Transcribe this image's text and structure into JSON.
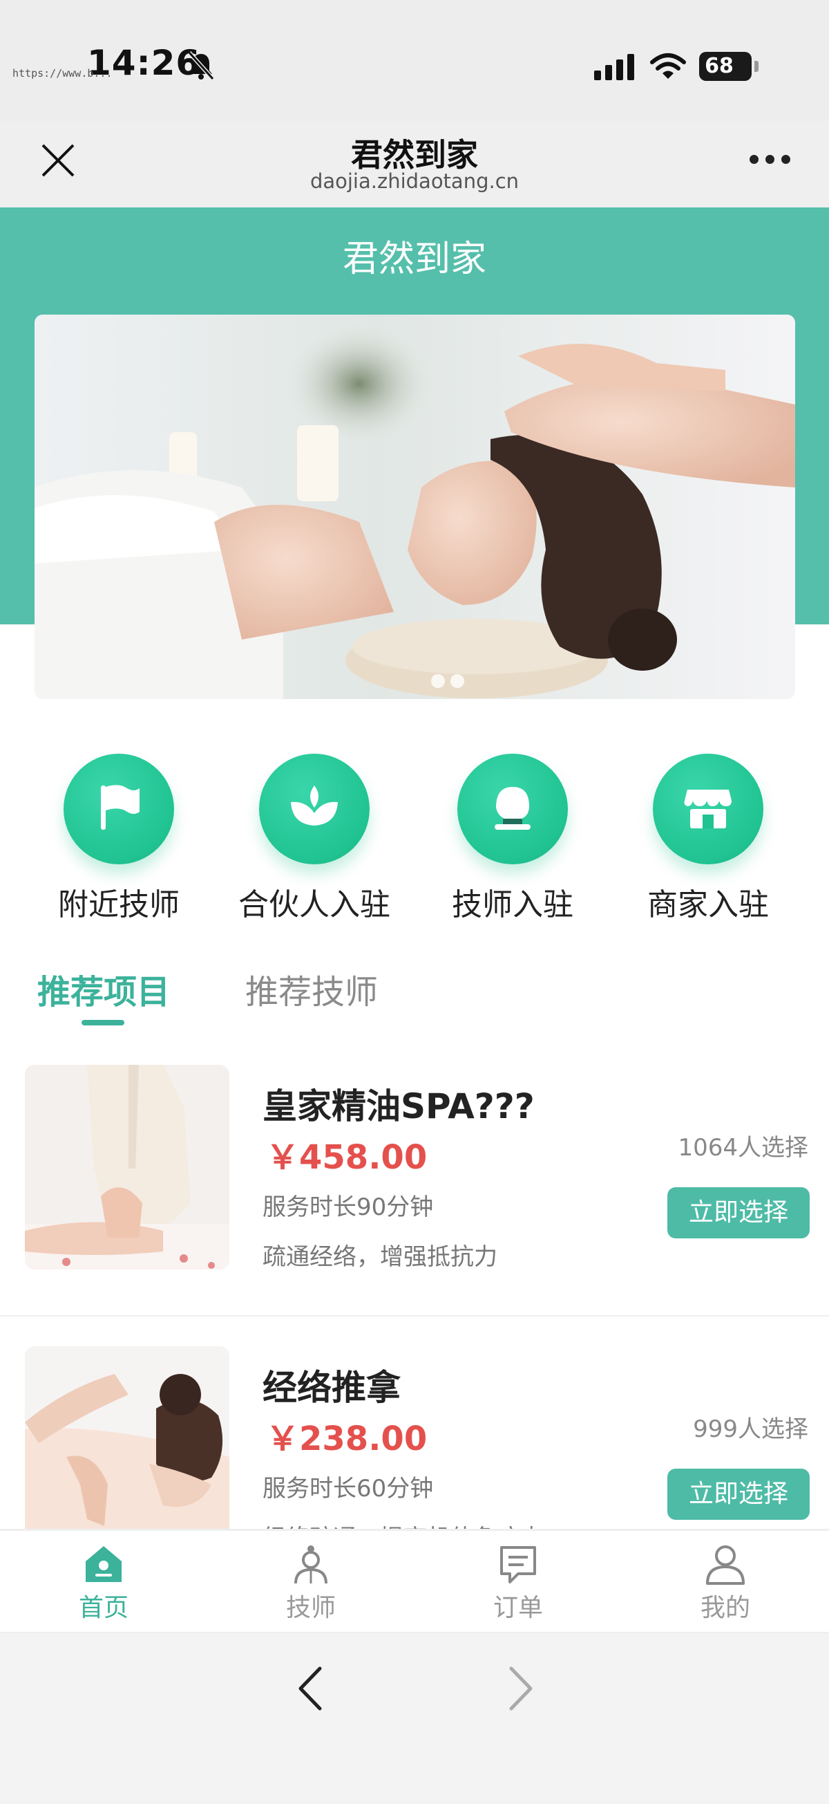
{
  "status_bar": {
    "time": "14:26",
    "battery": "68",
    "battery_level": 0.68,
    "url_overlay": "https://www.b..."
  },
  "nav": {
    "title": "君然到家",
    "domain": "daojia.zhidaotang.cn",
    "close_icon": "close-icon",
    "more_icon": "more-dots-icon"
  },
  "page": {
    "title": "君然到家",
    "banner_dots": 2,
    "theme_color": "#55bfab",
    "accent_color": "#3cb29b",
    "price_color": "#e4514d"
  },
  "quick_entries": [
    {
      "label": "附近技师",
      "icon": "flag-icon"
    },
    {
      "label": "合伙人入驻",
      "icon": "lotus-icon"
    },
    {
      "label": "技师入驻",
      "icon": "person-icon"
    },
    {
      "label": "商家入驻",
      "icon": "store-icon"
    }
  ],
  "tabs": [
    {
      "label": "推荐项目",
      "active": true
    },
    {
      "label": "推荐技师",
      "active": false
    }
  ],
  "services": [
    {
      "name": "皇家精油SPA???",
      "price": "￥458.00",
      "duration": "服务时长90分钟",
      "description": "疏通经络，增强抵抗力",
      "count": "1064人选择",
      "button": "立即选择"
    },
    {
      "name": "经络推拿",
      "price": "￥238.00",
      "duration": "服务时长60分钟",
      "description": "经络疏通，提高机体免疫力",
      "count": "999人选择",
      "button": "立即选择"
    }
  ],
  "tabbar": [
    {
      "label": "首页",
      "icon": "home-icon",
      "active": true
    },
    {
      "label": "技师",
      "icon": "technician-icon",
      "active": false
    },
    {
      "label": "订单",
      "icon": "order-icon",
      "active": false
    },
    {
      "label": "我的",
      "icon": "user-icon",
      "active": false
    }
  ],
  "browser": {
    "back_icon": "back-arrow-icon",
    "forward_icon": "forward-arrow-icon"
  }
}
